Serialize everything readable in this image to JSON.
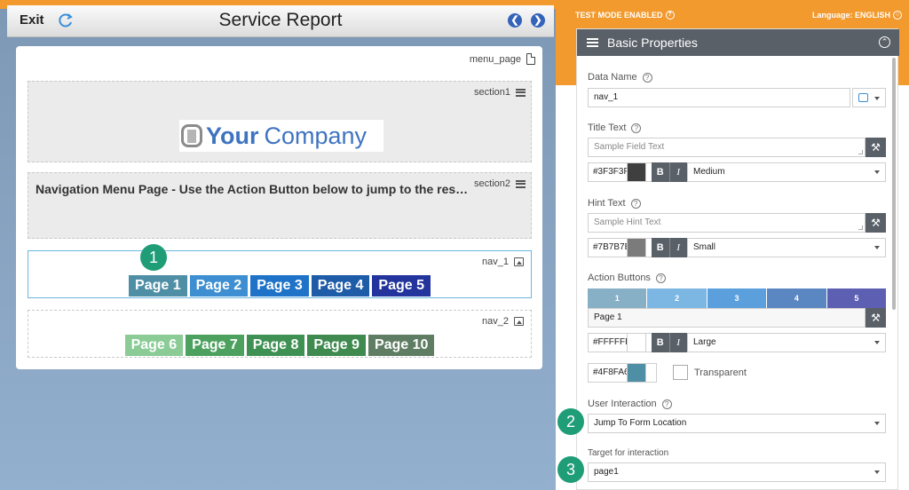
{
  "form": {
    "exit_label": "Exit",
    "title": "Service Report",
    "page_label": "menu_page",
    "section1_label": "section1",
    "section2_label": "section2",
    "logo_bold": "Your",
    "logo_light": "Company",
    "section2_text": "Navigation Menu Page - Use the Action Button below to jump to the respe...",
    "nav1_label": "nav_1",
    "nav2_label": "nav_2",
    "nav1_buttons": [
      {
        "label": "Page 1",
        "color": "#4F8FA6"
      },
      {
        "label": "Page 2",
        "color": "#3D8FD1"
      },
      {
        "label": "Page 3",
        "color": "#1E73C8"
      },
      {
        "label": "Page 4",
        "color": "#1E5CA8"
      },
      {
        "label": "Page 5",
        "color": "#23359C"
      }
    ],
    "nav2_buttons": [
      {
        "label": "Page 6",
        "color": "#8ACB96"
      },
      {
        "label": "Page 7",
        "color": "#4DA15E"
      },
      {
        "label": "Page 8",
        "color": "#3F9153"
      },
      {
        "label": "Page 9",
        "color": "#3E8A4F"
      },
      {
        "label": "Page 10",
        "color": "#5E7D63"
      }
    ]
  },
  "callouts": [
    "1",
    "2",
    "3"
  ],
  "panel": {
    "test_mode": "TEST MODE ENABLED",
    "language": "Language: ENGLISH",
    "header": "Basic Properties",
    "data_name_label": "Data Name",
    "data_name_value": "nav_1",
    "title_text_label": "Title Text",
    "title_text_placeholder": "Sample Field Text",
    "title_color": "#3F3F3F",
    "title_size": "Medium",
    "hint_text_label": "Hint Text",
    "hint_text_placeholder": "Sample Hint Text",
    "hint_color": "#7B7B7B",
    "hint_size": "Small",
    "action_buttons_label": "Action Buttons",
    "action_tabs": [
      {
        "label": "1",
        "color": "#87AFC5"
      },
      {
        "label": "2",
        "color": "#7CB6E3"
      },
      {
        "label": "3",
        "color": "#5BA0DD"
      },
      {
        "label": "4",
        "color": "#5A86C2"
      },
      {
        "label": "5",
        "color": "#5D5FB3"
      }
    ],
    "button_text": "Page 1",
    "button_text_color": "#FFFFFF",
    "button_size": "Large",
    "button_bg_color": "#4F8FA6",
    "transparent_label": "Transparent",
    "user_interaction_label": "User Interaction",
    "user_interaction_value": "Jump To Form Location",
    "target_label": "Target for interaction",
    "target_value": "page1",
    "bold_label": "B",
    "italic_label": "I"
  }
}
